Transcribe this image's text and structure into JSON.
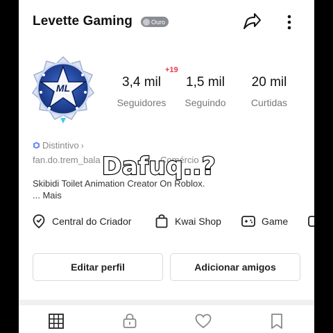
{
  "profile": {
    "name": "Levette Gaming",
    "badge_label": "Ouro"
  },
  "avatar": {
    "logo_text": "ML"
  },
  "stats": {
    "new_followers": "+19",
    "followers_value": "3,4 mil",
    "followers_label": "Seguidores",
    "following_value": "1,5 mil",
    "following_label": "Seguindo",
    "likes_value": "20 mil",
    "likes_label": "Curtidas"
  },
  "distintivo": {
    "label": "Distintivo"
  },
  "info": {
    "fan_text": "fan.do.trem_bala",
    "fan_text_2": "Comércio"
  },
  "bio": {
    "line1": "Skibidi Toilet Animation Creator On Roblox.",
    "more": "...  Mais"
  },
  "overlay_caption": "Dafuq..?",
  "shortcuts": [
    {
      "label": "Central do Criador",
      "icon": "location-pin-icon"
    },
    {
      "label": "Kwai Shop",
      "icon": "shopping-bag-icon"
    },
    {
      "label": "Game",
      "icon": "gamepad-icon"
    }
  ],
  "buttons": {
    "edit_profile": "Editar perfil",
    "add_friends": "Adicionar amigos"
  },
  "tabs": [
    {
      "icon": "grid-icon"
    },
    {
      "icon": "lock-icon"
    },
    {
      "icon": "heart-icon"
    },
    {
      "icon": "bookmark-icon"
    }
  ],
  "colors": {
    "accent_red": "#e8374a",
    "badge_gray": "#8a8d93",
    "avatar_blue": "#1f3f9a"
  }
}
